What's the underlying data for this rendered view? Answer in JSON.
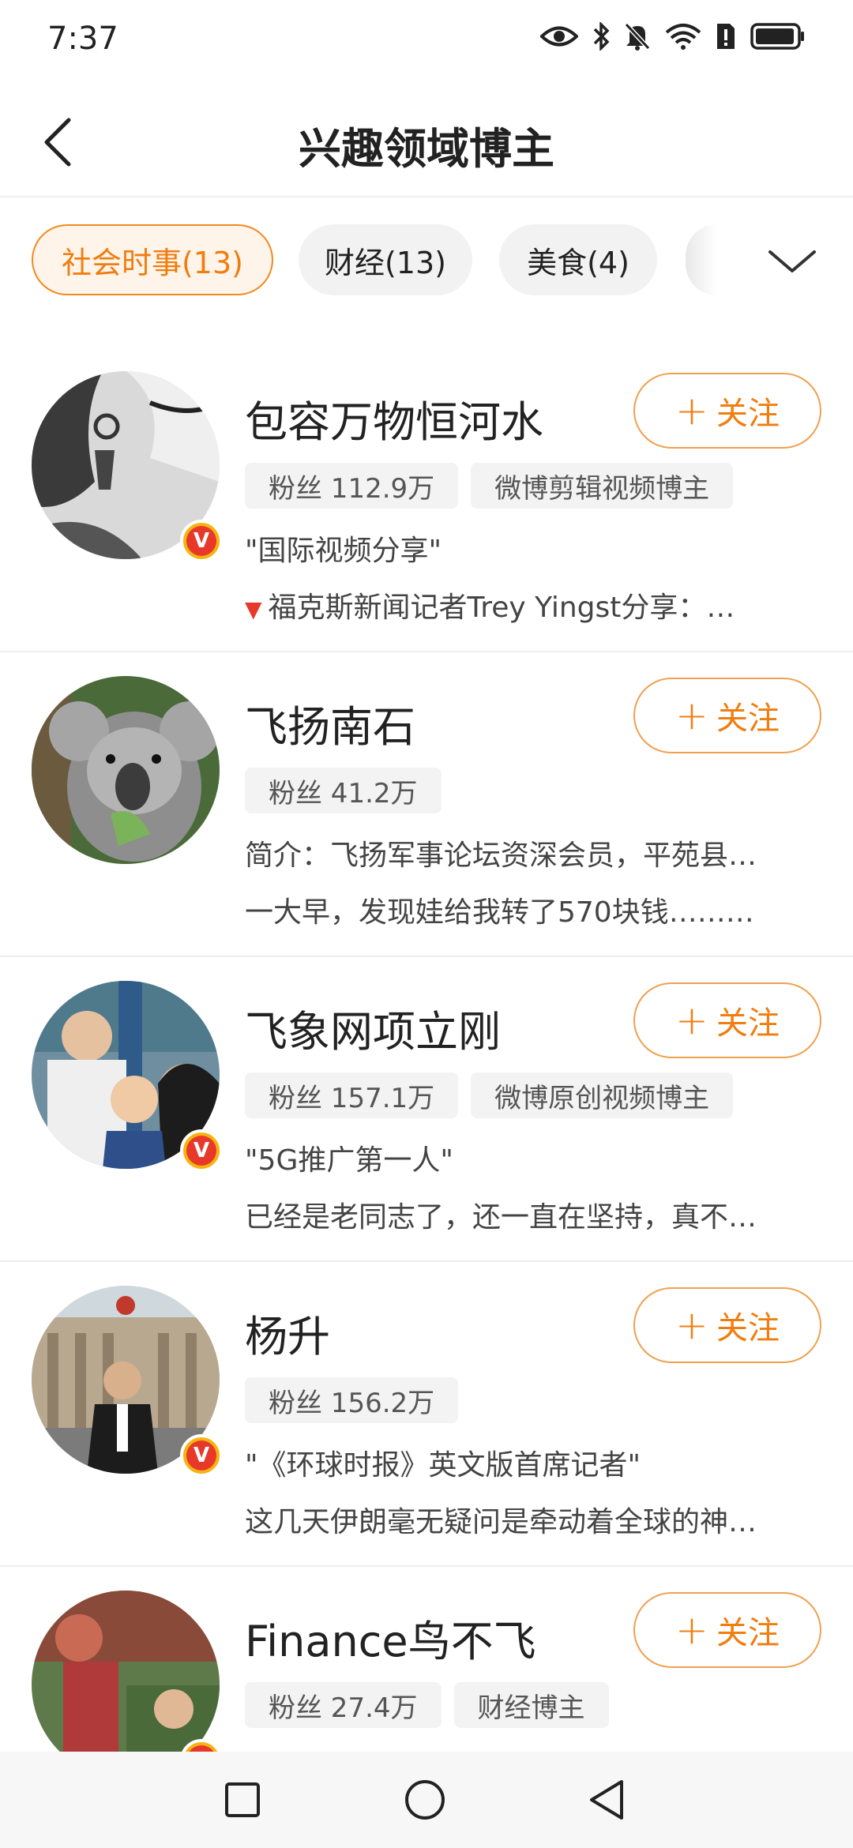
{
  "status_bar": {
    "time": "7:37",
    "icons": [
      "eye-icon",
      "bluetooth-icon",
      "mute-icon",
      "wifi-icon",
      "sim-alert-icon",
      "battery-icon"
    ]
  },
  "header": {
    "title": "兴趣领域博主",
    "back_icon": "chevron-left-icon"
  },
  "tabs": {
    "items": [
      {
        "label": "社会时事(13)",
        "active": true
      },
      {
        "label": "财经(13)",
        "active": false
      },
      {
        "label": "美食(4)",
        "active": false
      }
    ],
    "expand_icon": "chevron-down-icon"
  },
  "follow_label": "关注",
  "bloggers": [
    {
      "name": "包容万物恒河水",
      "fans": "粉丝 112.9万",
      "tag": "微博剪辑视频博主",
      "verified": true,
      "desc": "\"国际视频分享\"",
      "post": "福克斯新闻记者Trey Yingst分享：…",
      "post_marker": "red-triangle-icon"
    },
    {
      "name": "飞扬南石",
      "fans": "粉丝 41.2万",
      "tag": "",
      "verified": false,
      "desc": "简介：飞扬军事论坛资深会员，平苑县…",
      "post": "一大早，发现娃给我转了570块钱………"
    },
    {
      "name": "飞象网项立刚",
      "fans": "粉丝 157.1万",
      "tag": "微博原创视频博主",
      "verified": true,
      "desc": "\"5G推广第一人\"",
      "post": "已经是老同志了，还一直在坚持，真不…"
    },
    {
      "name": "杨升",
      "fans": "粉丝 156.2万",
      "tag": "",
      "verified": true,
      "desc": "\"《环球时报》英文版首席记者\"",
      "post": "这几天伊朗毫无疑问是牵动着全球的神…"
    },
    {
      "name": "Finance鸟不飞",
      "fans": "粉丝 27.4万",
      "tag": "财经博主",
      "verified": true,
      "desc": "",
      "post": ""
    }
  ],
  "colors": {
    "accent": "#f07d0f",
    "verified_badge": "#f6b410",
    "chip_active_bg": "#fff4ea"
  },
  "navbar": {
    "icons": [
      "recents-square-icon",
      "home-circle-icon",
      "back-triangle-icon"
    ]
  }
}
